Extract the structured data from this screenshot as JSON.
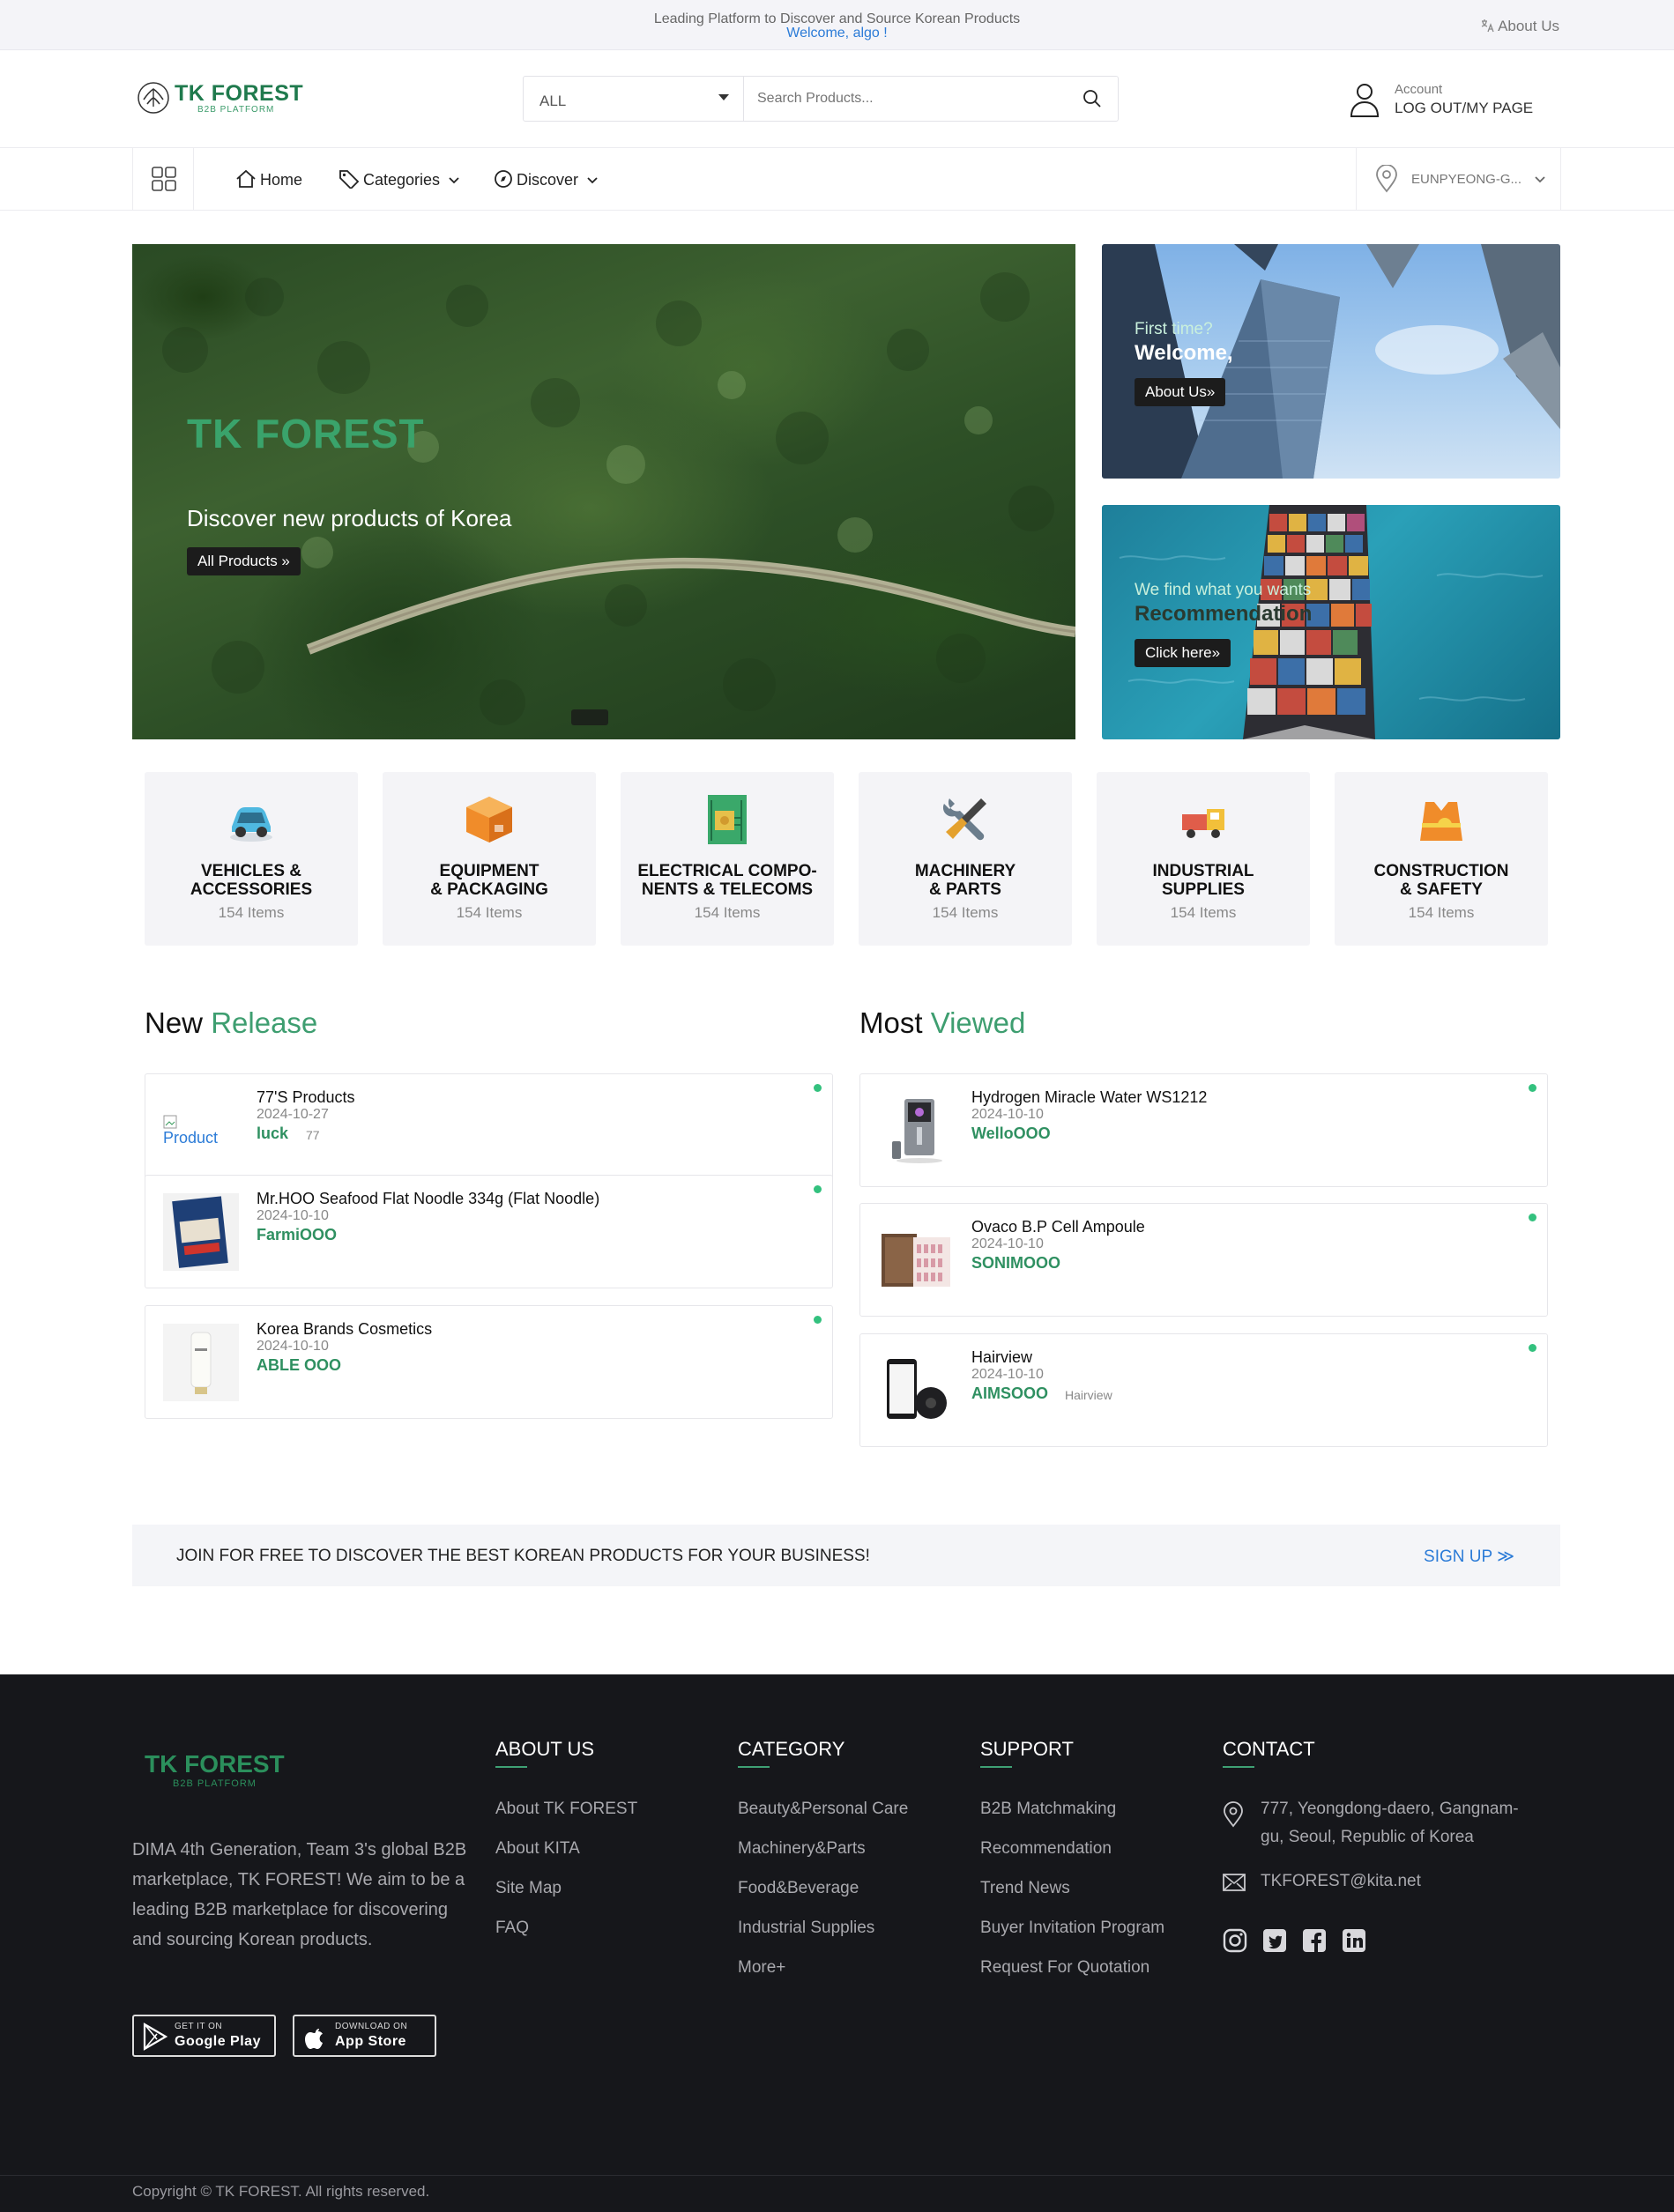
{
  "topbar": {
    "tagline": "Leading Platform to Discover and Source Korean Products",
    "welcome": "Welcome, algo !",
    "about": "About Us"
  },
  "header": {
    "logo_text": "TK FOREST",
    "logo_sub": "B2B PLATFORM",
    "search_category": "ALL",
    "search_placeholder": "Search Products...",
    "account_label": "Account",
    "account_link": "LOG OUT/MY PAGE"
  },
  "nav": {
    "home": "Home",
    "categories": "Categories",
    "discover": "Discover",
    "location": "EUNPYEONG-G..."
  },
  "hero": {
    "title": "TK FOREST",
    "subtitle": "Discover new products of Korea",
    "button": "All Products »",
    "side1_small": "First time?",
    "side1_big": "Welcome,",
    "side1_button": "About Us»",
    "side2_small": "We find what you wants",
    "side2_big": "Recommendation",
    "side2_button": "Click here»"
  },
  "categories": [
    {
      "name1": "VEHICLES &",
      "name2": "ACCESSORIES",
      "count": "154 Items",
      "icon": "car-icon"
    },
    {
      "name1": "EQUIPMENT",
      "name2": "& PACKAGING",
      "count": "154 Items",
      "icon": "box-icon"
    },
    {
      "name1": "ELECTRICAL COMPO-",
      "name2": "NENTS & TELECOMS",
      "count": "154 Items",
      "icon": "circuit-board-icon"
    },
    {
      "name1": "MACHINERY",
      "name2": "& PARTS",
      "count": "154 Items",
      "icon": "tools-icon"
    },
    {
      "name1": "INDUSTRIAL",
      "name2": "SUPPLIES",
      "count": "154 Items",
      "icon": "truck-icon"
    },
    {
      "name1": "CONSTRUCTION",
      "name2": "& SAFETY",
      "count": "154 Items",
      "icon": "safety-vest-icon"
    }
  ],
  "new_release": {
    "title_plain": "New",
    "title_accent": "Release",
    "items": [
      {
        "name": "77'S Products",
        "date": "2024-10-27",
        "company": "luck",
        "tag": "77",
        "thumb_alt": "Product"
      },
      {
        "name": "Mr.HOO Seafood Flat Noodle 334g (Flat Noodle)",
        "date": "2024-10-10",
        "company": "FarmiOOO",
        "tag": ""
      },
      {
        "name": "Korea Brands Cosmetics",
        "date": "2024-10-10",
        "company": "ABLE OOO",
        "tag": ""
      }
    ]
  },
  "most_viewed": {
    "title_plain": "Most",
    "title_accent": "Viewed",
    "items": [
      {
        "name": "Hydrogen Miracle Water WS1212",
        "date": "2024-10-10",
        "company": "WelloOOO",
        "tag": ""
      },
      {
        "name": "Ovaco B.P Cell Ampoule",
        "date": "2024-10-10",
        "company": "SONIMOOO",
        "tag": ""
      },
      {
        "name": "Hairview",
        "date": "2024-10-10",
        "company": "AIMSOOO",
        "tag": "Hairview"
      }
    ]
  },
  "join": {
    "text": "JOIN FOR FREE TO DISCOVER THE BEST KOREAN PRODUCTS FOR YOUR BUSINESS!",
    "signup": "SIGN UP ≫"
  },
  "footer": {
    "logo_text": "TK FOREST",
    "logo_sub": "B2B PLATFORM",
    "description": "DIMA 4th Generation, Team 3's global B2B marketplace, TK FOREST! We aim to be a leading B2B marketplace for discovering and sourcing Korean products.",
    "google_small": "GET IT ON",
    "google_big": "Google Play",
    "apple_small": "DOWNLOAD ON",
    "apple_big": "App Store",
    "about_title": "ABOUT US",
    "about_links": [
      "About TK FOREST",
      "About KITA",
      "Site Map",
      "FAQ"
    ],
    "category_title": "CATEGORY",
    "category_links": [
      "Beauty&Personal Care",
      "Machinery&Parts",
      "Food&Beverage",
      "Industrial Supplies",
      "More+"
    ],
    "support_title": "SUPPORT",
    "support_links": [
      "B2B Matchmaking",
      "Recommendation",
      "Trend News",
      "Buyer Invitation Program",
      "Request For Quotation"
    ],
    "contact_title": "CONTACT",
    "address_line1": "777, Yeongdong-daero, Gangnam-",
    "address_line2": "gu, Seoul, Republic of Korea",
    "email": "TKFOREST@kita.net",
    "copyright": "Copyright © TK FOREST. All rights reserved."
  },
  "colors": {
    "brand_green": "#3e9e70",
    "link_blue": "#2b7bd7",
    "footer_bg": "#16171b",
    "status_dot": "#33c17e"
  }
}
